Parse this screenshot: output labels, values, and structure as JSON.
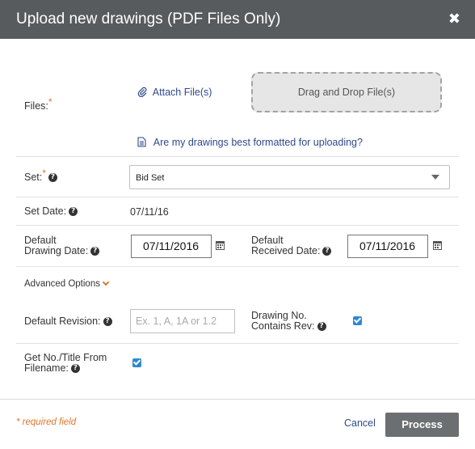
{
  "dialog": {
    "title": "Upload new drawings (PDF Files Only)",
    "close_glyph": "✖"
  },
  "files": {
    "label": "Files:",
    "required_mark": "*",
    "attach_label": "Attach File(s)",
    "attach_icon": "paperclip-icon",
    "dropzone_label": "Drag and Drop File(s)",
    "format_link": "Are my drawings best formatted for uploading?",
    "format_icon": "document-icon"
  },
  "set": {
    "label": "Set:",
    "required_mark": "*",
    "selected": "Bid Set"
  },
  "set_date": {
    "label": "Set Date:",
    "value": "07/11/16"
  },
  "drawing_date": {
    "label_line1": "Default",
    "label_line2": "Drawing Date:",
    "value": "07/11/2016"
  },
  "received_date": {
    "label_line1": "Default",
    "label_line2": "Received Date:",
    "value": "07/11/2016"
  },
  "advanced": {
    "label": "Advanced Options"
  },
  "revision": {
    "label": "Default Revision:",
    "placeholder": "Ex. 1, A, 1A or 1.2",
    "value": ""
  },
  "contains_rev": {
    "label_line1": "Drawing No.",
    "label_line2": "Contains Rev:",
    "checked": true
  },
  "from_filename": {
    "label_line1": "Get No./Title From",
    "label_line2": "Filename:",
    "checked": true
  },
  "footer": {
    "required_note": "* required field",
    "cancel_label": "Cancel",
    "process_label": "Process"
  },
  "colors": {
    "header_bg": "#585b5e",
    "accent_orange": "#e0762c",
    "link_blue": "#2e4a8a",
    "checkbox_blue": "#2f88d4",
    "process_bg": "#6c6f72"
  }
}
